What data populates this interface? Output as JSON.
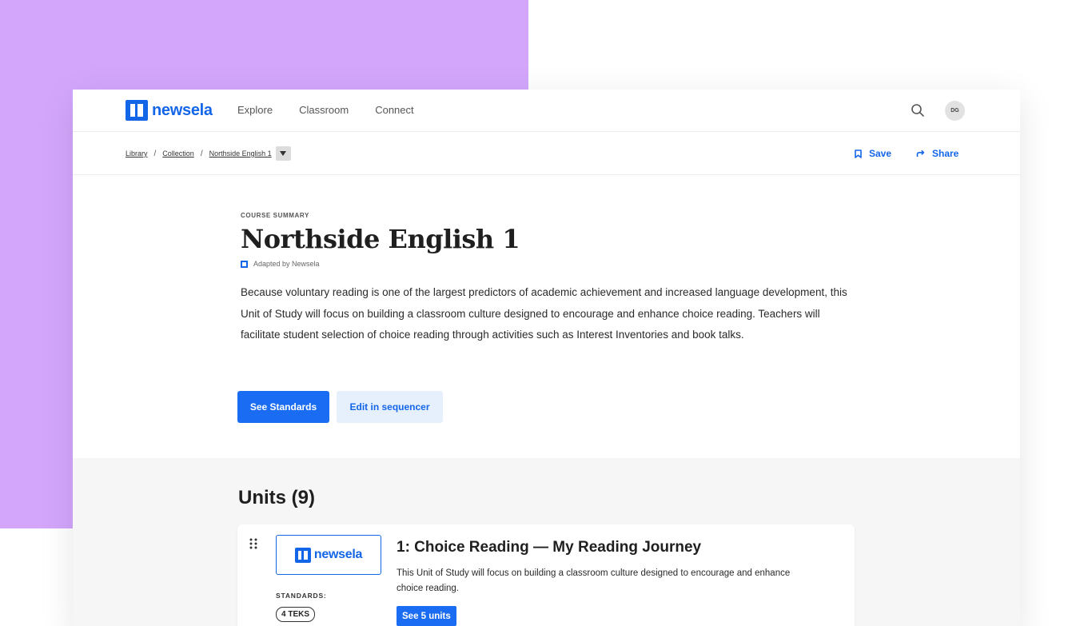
{
  "brand": {
    "name": "newsela",
    "color": "#1466e8"
  },
  "nav": {
    "links": [
      "Explore",
      "Classroom",
      "Connect"
    ],
    "avatar_initials": "DG",
    "search_icon": "search-icon"
  },
  "breadcrumb": {
    "items": [
      "Library",
      "Collection",
      "Northside English 1"
    ],
    "separator": "/"
  },
  "actions": {
    "save_label": "Save",
    "share_label": "Share"
  },
  "summary": {
    "eyebrow": "COURSE SUMMARY",
    "title": "Northside English 1",
    "adapted": "Adapted by Newsela",
    "description": "Because voluntary reading is one of the largest predictors of academic achievement and increased language development, this Unit of Study will focus on building a classroom culture designed to encourage and enhance choice reading. Teachers will facilitate student selection of choice reading through activities such as Interest Inventories and book talks.",
    "see_standards_label": "See Standards",
    "edit_sequencer_label": "Edit in sequencer"
  },
  "units": {
    "heading": "Units (9)",
    "items": [
      {
        "thumb_brand": "newsela",
        "standards_label": "STANDARDS:",
        "standards_badge": "4 TEKS",
        "title": "1: Choice Reading — My Reading Journey",
        "description": "This Unit of Study will focus on building a classroom culture designed to encourage and enhance choice reading.",
        "see_units_label": "See 5 units"
      }
    ]
  },
  "colors": {
    "background_accent": "#d3a6fc",
    "primary": "#1a6df2",
    "secondary_bg": "#e6f0fd"
  }
}
